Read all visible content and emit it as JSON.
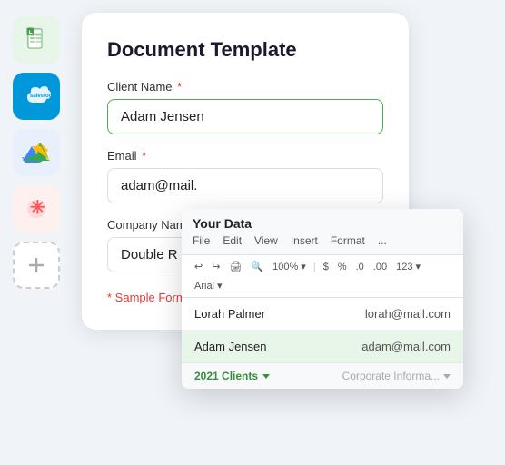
{
  "sidebar": {
    "icons": [
      {
        "id": "sheets",
        "label": "Google Sheets",
        "type": "sheets"
      },
      {
        "id": "salesforce",
        "label": "Salesforce",
        "type": "salesforce"
      },
      {
        "id": "drive",
        "label": "Google Drive",
        "type": "drive"
      },
      {
        "id": "asterisk",
        "label": "Asterisk App",
        "type": "asterisk"
      },
      {
        "id": "add",
        "label": "Add Integration",
        "type": "add"
      }
    ]
  },
  "form": {
    "title": "Document Template",
    "fields": [
      {
        "label": "Client Name",
        "required": true,
        "value": "Adam Jensen",
        "placeholder": "Adam Jensen",
        "highlight": true
      },
      {
        "label": "Email",
        "required": true,
        "value": "adam@mail.",
        "placeholder": "",
        "highlight": false
      },
      {
        "label": "Company Name",
        "required": false,
        "value": "Double R",
        "placeholder": "",
        "highlight": false
      }
    ],
    "note": "* Sample Form"
  },
  "spreadsheet": {
    "title": "Your Data",
    "menu": [
      "File",
      "Edit",
      "View",
      "Insert",
      "Format",
      "..."
    ],
    "toolbar": [
      "↩",
      "↪",
      "🖨",
      "🔍",
      "100%",
      "▾",
      "$",
      "%",
      ".0",
      ".00",
      "123▾",
      "Arial",
      "▾"
    ],
    "rows": [
      {
        "name": "Lorah Palmer",
        "email": "lorah@mail.com"
      },
      {
        "name": "Adam Jensen",
        "email": "adam@mail.com"
      }
    ],
    "footer": {
      "tab_label": "2021 Clients",
      "col_label": "Corporate Informa..."
    }
  }
}
